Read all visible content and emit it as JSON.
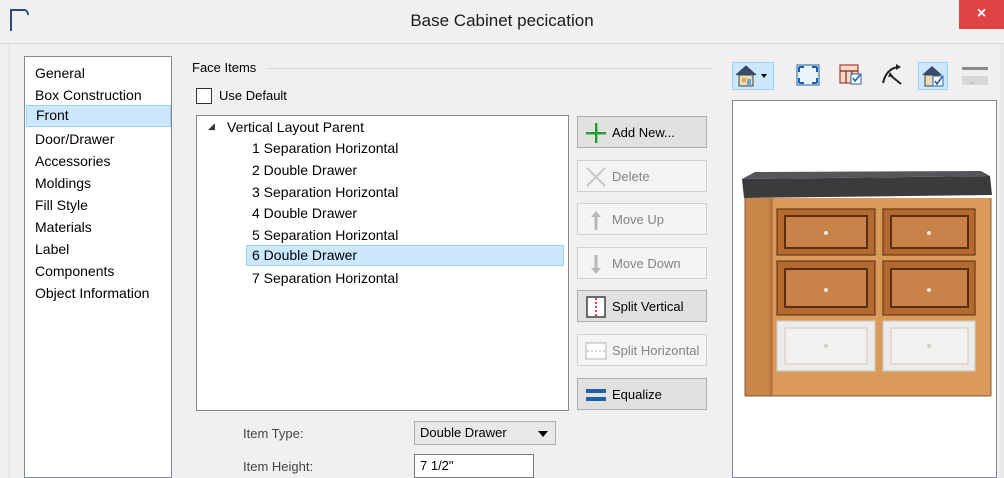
{
  "window": {
    "title": "Base Cabinet pecication",
    "close_label": "×"
  },
  "sidebar": {
    "items": [
      {
        "label": "General"
      },
      {
        "label": "Box Construction"
      },
      {
        "label": "Front"
      },
      {
        "label": "Door/Drawer"
      },
      {
        "label": "Accessories"
      },
      {
        "label": "Moldings"
      },
      {
        "label": "Fill Style"
      },
      {
        "label": "Materials"
      },
      {
        "label": "Label"
      },
      {
        "label": "Components"
      },
      {
        "label": "Object Information"
      }
    ],
    "selected": "Front"
  },
  "face_items": {
    "group_label": "Face Items",
    "use_default_label": "Use Default",
    "use_default_checked": false,
    "tree": {
      "root": "Vertical Layout Parent",
      "items": [
        {
          "label": "1 Separation Horizontal"
        },
        {
          "label": "2 Double Drawer"
        },
        {
          "label": "3 Separation Horizontal"
        },
        {
          "label": "4 Double Drawer"
        },
        {
          "label": "5 Separation Horizontal"
        },
        {
          "label": "6 Double Drawer"
        },
        {
          "label": "7 Separation Horizontal"
        }
      ],
      "selected": "6 Double Drawer"
    }
  },
  "buttons": {
    "add_new": "Add New...",
    "delete": "Delete",
    "move_up": "Move Up",
    "move_down": "Move Down",
    "split_vertical": "Split Vertical",
    "split_horizontal": "Split Horizontal",
    "equalize": "Equalize"
  },
  "fields": {
    "item_type_label": "Item Type:",
    "item_type_value": "Double Drawer",
    "item_height_label": "Item Height:",
    "item_height_value": "7 1/2\""
  },
  "colors": {
    "accent_selection": "#cce8ff",
    "close_button": "#e04343",
    "countertop": "#3b3b3d",
    "cabinet_wood": "#d99a5b"
  }
}
